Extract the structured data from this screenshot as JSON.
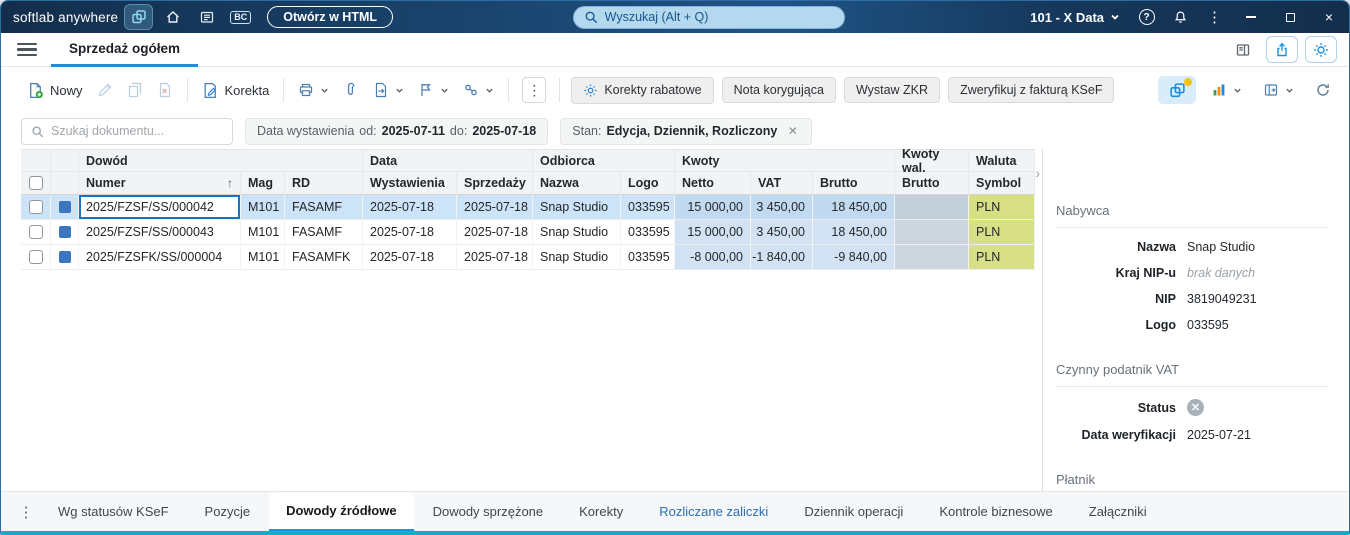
{
  "colors": {
    "accent": "#1d8fe0",
    "titlebar": "#1c4a77",
    "amount_column_bg": "#d2e2f2",
    "currency_column_bg": "#d8e087",
    "amount_wal_column_bg": "#cdd6de",
    "selected_row_bg": "#cde4f8",
    "ksef_notification_dot": "#f2c217",
    "window_bottom_border": "#12aec9"
  },
  "titlebar": {
    "app_name": "softlab anywhere",
    "bc_badge": "BC",
    "open_html_button": "Otwórz w HTML",
    "search_placeholder": "Wyszukaj (Alt + Q)",
    "workspace": "101 - X Data"
  },
  "tabs": {
    "active": "Sprzedaż ogółem"
  },
  "toolbar": {
    "new": "Nowy",
    "correction": "Korekta",
    "discount_corrections": "Korekty rabatowe",
    "correction_note": "Nota korygująca",
    "issue_zkr": "Wystaw ZKR",
    "verify_ksef": "Zweryfikuj z fakturą KSeF"
  },
  "filters": {
    "search_placeholder": "Szukaj dokumentu...",
    "issue_date": {
      "label": "Data wystawienia",
      "from_label": "od:",
      "from": "2025-07-11",
      "to_label": "do:",
      "to": "2025-07-18"
    },
    "state": {
      "label": "Stan:",
      "value": "Edycja, Dziennik, Rozliczony"
    }
  },
  "table": {
    "group_headers": {
      "dowod": "Dowód",
      "data": "Data",
      "odbiorca": "Odbiorca",
      "kwoty": "Kwoty",
      "kwoty_wal": "Kwoty wal.",
      "waluta": "Waluta"
    },
    "columns": {
      "numer": "Numer",
      "mag": "Mag",
      "rd": "RD",
      "wystawienia": "Wystawienia",
      "sprzedazy": "Sprzedaży",
      "nazwa": "Nazwa",
      "logo": "Logo",
      "netto": "Netto",
      "vat": "VAT",
      "brutto": "Brutto",
      "brutto_wal": "Brutto",
      "symbol": "Symbol"
    },
    "sort_indicator": "↑",
    "rows": [
      {
        "numer": "2025/FZSF/SS/000042",
        "mag": "M101",
        "rd": "FASAMF",
        "wystawienia": "2025-07-18",
        "sprzedazy": "2025-07-18",
        "nazwa": "Snap Studio",
        "logo": "033595",
        "netto": "15 000,00",
        "vat": "3 450,00",
        "brutto": "18 450,00",
        "brutto_wal": "",
        "symbol": "PLN"
      },
      {
        "numer": "2025/FZSF/SS/000043",
        "mag": "M101",
        "rd": "FASAMF",
        "wystawienia": "2025-07-18",
        "sprzedazy": "2025-07-18",
        "nazwa": "Snap Studio",
        "logo": "033595",
        "netto": "15 000,00",
        "vat": "3 450,00",
        "brutto": "18 450,00",
        "brutto_wal": "",
        "symbol": "PLN"
      },
      {
        "numer": "2025/FZSFK/SS/000004",
        "mag": "M101",
        "rd": "FASAMFK",
        "wystawienia": "2025-07-18",
        "sprzedazy": "2025-07-18",
        "nazwa": "Snap Studio",
        "logo": "033595",
        "netto": "-8 000,00",
        "vat": "-1 840,00",
        "brutto": "-9 840,00",
        "brutto_wal": "",
        "symbol": "PLN"
      }
    ]
  },
  "details": {
    "buyer_section": "Nabywca",
    "buyer": {
      "name_label": "Nazwa",
      "name": "Snap Studio",
      "nip_country_label": "Kraj NIP-u",
      "nip_country": "brak danych",
      "nip_label": "NIP",
      "nip": "3819049231",
      "logo_label": "Logo",
      "logo": "033595"
    },
    "vat_section": "Czynny podatnik VAT",
    "vat": {
      "status_label": "Status",
      "verify_date_label": "Data weryfikacji",
      "verify_date": "2025-07-21"
    },
    "payer_section": "Płatnik"
  },
  "bottom_tabs": [
    {
      "label": "Wg statusów KSeF"
    },
    {
      "label": "Pozycje"
    },
    {
      "label": "Dowody źródłowe"
    },
    {
      "label": "Dowody sprzężone"
    },
    {
      "label": "Korekty"
    },
    {
      "label": "Rozliczane zaliczki"
    },
    {
      "label": "Dziennik operacji"
    },
    {
      "label": "Kontrole biznesowe"
    },
    {
      "label": "Załączniki"
    }
  ]
}
